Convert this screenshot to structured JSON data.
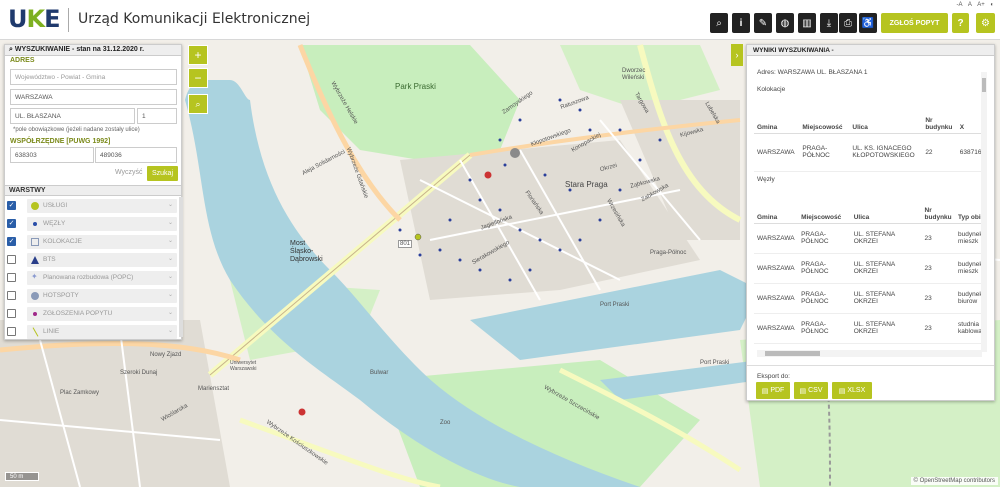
{
  "header": {
    "logo_u": "U",
    "logo_k": "K",
    "logo_e": "E",
    "title": "Urząd Komunikacji Elektronicznej",
    "font_small": "-A",
    "font_normal": "A",
    "font_large": "A+",
    "contrast": "◐",
    "report_label": "ZGŁOŚ POPYT",
    "help_label": "?"
  },
  "toolbar_icons": [
    "search-icon",
    "info-icon",
    "ruler-icon",
    "globe-icon",
    "layers-book-icon",
    "download-icon",
    "print-icon",
    "accessibility-icon"
  ],
  "search": {
    "title": "WYSZUKIWANIE - stan na 31.12.2020 r.",
    "address_label": "ADRES",
    "region_placeholder": "Województwo - Powiat - Gmina",
    "city_value": "WARSZAWA",
    "street_value": "UL. BŁASZANA",
    "number_value": "1",
    "required_note": "*pole obowiązkowe (jeżeli nadane zostały ulice)",
    "coords_label": "WSPÓŁRZĘDNE [PUWG 1992]",
    "x_value": "638303",
    "y_value": "489036",
    "clear_label": "Wyczyść",
    "search_label": "Szukaj"
  },
  "layers": {
    "title": "WARSTWY",
    "items": [
      {
        "name": "USŁUGI",
        "checked": true,
        "color": "#b6c420"
      },
      {
        "name": "WĘZŁY",
        "checked": true,
        "color": "#2a4ea8"
      },
      {
        "name": "KOLOKACJE",
        "checked": true,
        "color": "#8a9ab8"
      },
      {
        "name": "BTS",
        "checked": false,
        "color": "#2a3e8a"
      },
      {
        "name": "Planowana rozbudowa (POPC)",
        "checked": false,
        "color": "#8a9ad0"
      },
      {
        "name": "HOTSPOTY",
        "checked": false,
        "color": "#8a9ab8"
      },
      {
        "name": "ZGŁOSZENIA POPYTU",
        "checked": false,
        "color": "#a02a8a"
      },
      {
        "name": "LINIE",
        "checked": false,
        "color": "#b6c420"
      }
    ]
  },
  "zoom": {
    "in": "+",
    "out": "−",
    "search": "⌕"
  },
  "results": {
    "title": "WYNIKI WYSZUKIWANIA -",
    "address": "Adres: WARSZAWA UL. BŁASZANA 1",
    "kolokacje_label": "Kolokacje",
    "kol_headers": [
      "Gmina",
      "Miejscowość",
      "Ulica",
      "Nr budynku",
      "X"
    ],
    "kol_rows": [
      [
        "WARSZAWA",
        "PRAGA-PÓŁNOC",
        "UL. KS. IGNACEGO KŁOPOTOWSKIEGO",
        "22",
        "638716"
      ]
    ],
    "wezly_label": "Węzły",
    "wez_headers": [
      "Gmina",
      "Miejscowość",
      "Ulica",
      "Nr budynku",
      "Typ obi"
    ],
    "wez_rows": [
      [
        "WARSZAWA",
        "PRAGA-PÓŁNOC",
        "UL. STEFANA OKRZEI",
        "23",
        "budynek mieszk"
      ],
      [
        "WARSZAWA",
        "PRAGA-PÓŁNOC",
        "UL. STEFANA OKRZEI",
        "23",
        "budynek mieszk"
      ],
      [
        "WARSZAWA",
        "PRAGA-PÓŁNOC",
        "UL. STEFANA OKRZEI",
        "23",
        "budynek biurow"
      ],
      [
        "WARSZAWA",
        "PRAGA-PÓŁNOC",
        "UL. STEFANA OKRZEI",
        "23",
        "studnia kablowa"
      ]
    ],
    "export_label": "Eksport do:",
    "export_buttons": [
      "PDF",
      "CSV",
      "XLSX"
    ]
  },
  "map": {
    "labels": [
      "Park Praski",
      "Stara Praga",
      "Most Śląsko-Dąbrowski",
      "Port Praski",
      "Port Praski",
      "Dworzec Wileński",
      "Zoo",
      "Praga-Północ",
      "Mariensztat",
      "Nowy Zjazd",
      "Aleja Solidarności",
      "Wybrzeże Szczecińskie",
      "Wybrzeże Helskie",
      "Jagiellońska",
      "Targowa",
      "Okrzei",
      "Zamoyskiego",
      "Zabkowska",
      "Kłopotowskiego",
      "Sierakowskiego",
      "Konopackiej",
      "Ratuszowa",
      "Wrzesińska",
      "Floriańska",
      "Plac Zamkowy",
      "Wybrzeże Kościuszkowskie",
      "Uniwersytet Warszawski",
      "Bulwar",
      "Wybrzeże Gdańskie",
      "Szeroki Dunaj",
      "Wioślarska",
      "801",
      "Kijowska",
      "Ząbkowska",
      "Lubelska"
    ],
    "scale_label": "50 m",
    "attribution": "© OpenStreetMap contributors"
  }
}
